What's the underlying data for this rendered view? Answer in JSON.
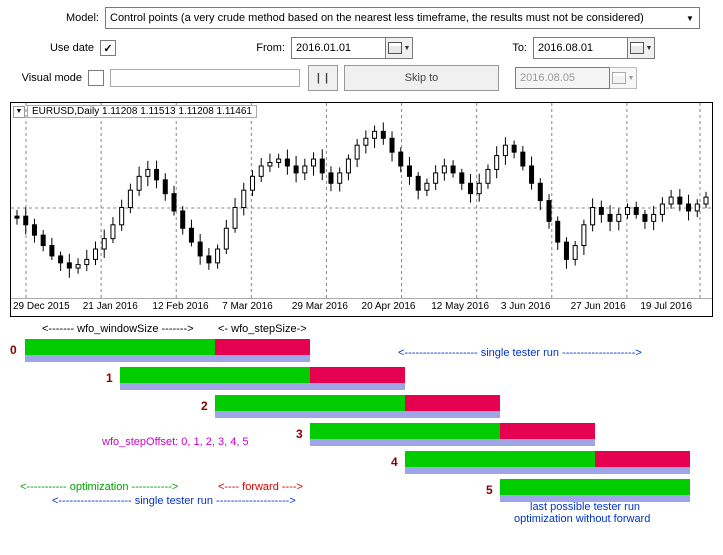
{
  "form": {
    "model_label": "Model:",
    "model_value": "Control points (a very crude method based on the nearest less timeframe, the results must not be considered)",
    "use_date_label": "Use date",
    "use_date_checked": "✓",
    "from_label": "From:",
    "from_value": "2016.01.01",
    "to_label": "To:",
    "to_value": "2016.08.01",
    "visual_label": "Visual mode",
    "pause_label": "| |",
    "skip_label": "Skip to",
    "skip_date": "2016.08.05"
  },
  "chart": {
    "title": "EURUSD,Daily 1.11208 1.11513 1.11208 1.11461",
    "xaxis": [
      "29 Dec 2015",
      "21 Jan 2016",
      "12 Feb 2016",
      "7 Mar 2016",
      "29 Mar 2016",
      "20 Apr 2016",
      "12 May 2016",
      "3 Jun 2016",
      "27 Jun 2016",
      "19 Jul 2016"
    ]
  },
  "chart_data": {
    "type": "candlestick",
    "symbol": "EURUSD",
    "timeframe": "Daily",
    "ohlc_current": {
      "open": 1.11208,
      "high": 1.11513,
      "low": 1.11208,
      "close": 1.11461
    },
    "x_ticks": [
      "29 Dec 2015",
      "21 Jan 2016",
      "12 Feb 2016",
      "7 Mar 2016",
      "29 Mar 2016",
      "20 Apr 2016",
      "12 May 2016",
      "3 Jun 2016",
      "27 Jun 2016",
      "19 Jul 2016"
    ],
    "y_range_approx": [
      1.07,
      1.16
    ],
    "dashed_midline": 1.115
  },
  "diagram": {
    "wsize_label": "<-------   wfo_windowSize   ------->",
    "stepsize_label": "<- wfo_stepSize->",
    "single_run_top": "<-------------------- single tester run -------------------->",
    "single_run_bottom": "<-------------------- single tester run -------------------->",
    "optimization_label": "<----------- optimization ----------->",
    "forward_label": "<---- forward ---->",
    "stepoffset_label": "wfo_stepOffset: 0, 1, 2, 3, 4, 5",
    "last_possible": "last possible tester run",
    "opt_without_fwd": "optimization without forward",
    "steps": [
      "0",
      "1",
      "2",
      "3",
      "4",
      "5"
    ]
  }
}
